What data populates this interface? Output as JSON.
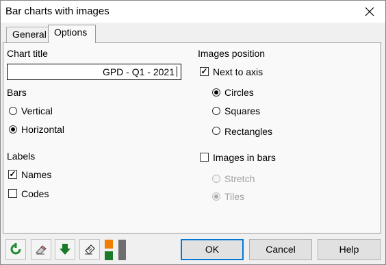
{
  "window": {
    "title": "Bar charts with images"
  },
  "tabs": [
    {
      "label": "General",
      "active": false
    },
    {
      "label": "Options",
      "active": true
    }
  ],
  "chart_title": {
    "label": "Chart title",
    "value": "GPD - Q1 - 2021"
  },
  "bars": {
    "label": "Bars",
    "options": [
      {
        "label": "Vertical",
        "checked": false
      },
      {
        "label": "Horizontal",
        "checked": true
      }
    ]
  },
  "labels": {
    "label": "Labels",
    "options": [
      {
        "label": "Names",
        "checked": true
      },
      {
        "label": "Codes",
        "checked": false
      }
    ]
  },
  "images_position": {
    "label": "Images position",
    "next_to_axis": {
      "label": "Next to axis",
      "checked": true
    },
    "shapes": [
      {
        "label": "Circles",
        "checked": true
      },
      {
        "label": "Squares",
        "checked": false
      },
      {
        "label": "Rectangles",
        "checked": false
      }
    ],
    "images_in_bars": {
      "label": "Images in bars",
      "checked": false
    },
    "fill": [
      {
        "label": "Stretch",
        "checked": false,
        "disabled": true
      },
      {
        "label": "Tiles",
        "checked": true,
        "disabled": true
      }
    ]
  },
  "toolbar": {
    "icons": [
      "reset-icon",
      "eraser-icon",
      "download-arrow-icon",
      "clear-selection-icon",
      "color-swatch-icon"
    ],
    "colors": {
      "green": "#1e8c2e",
      "orange": "#f07d00",
      "dark_green": "#1a7a2a",
      "gray": "#6e6e6e"
    }
  },
  "buttons": {
    "ok": "OK",
    "cancel": "Cancel",
    "help": "Help"
  }
}
